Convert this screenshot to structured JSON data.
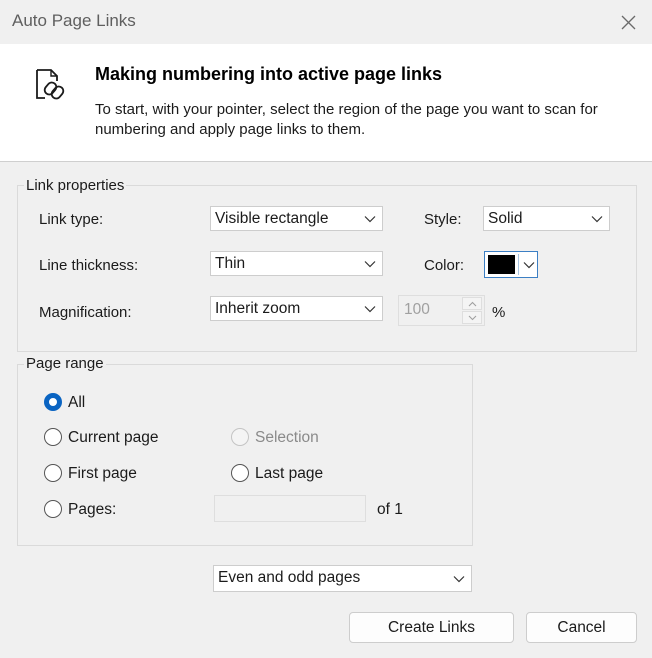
{
  "window": {
    "title": "Auto Page Links"
  },
  "header": {
    "icon": "page-link-icon",
    "heading": "Making numbering into active page links",
    "description": "To start, with your pointer, select the region of the page you want to scan for numbering and apply page links to them."
  },
  "link_properties": {
    "legend": "Link properties",
    "link_type_label": "Link type:",
    "link_type_value": "Visible rectangle",
    "style_label": "Style:",
    "style_value": "Solid",
    "line_thickness_label": "Line thickness:",
    "line_thickness_value": "Thin",
    "color_label": "Color:",
    "color_value": "#000000",
    "magnification_label": "Magnification:",
    "magnification_value": "Inherit zoom",
    "zoom_value": "100",
    "zoom_unit": "%"
  },
  "page_range": {
    "legend": "Page range",
    "all_label": "All",
    "current_page_label": "Current page",
    "selection_label": "Selection",
    "first_page_label": "First page",
    "last_page_label": "Last page",
    "pages_label": "Pages:",
    "pages_value": "",
    "of_label": "of 1",
    "selected": "All"
  },
  "subset": {
    "value": "Even and odd pages"
  },
  "buttons": {
    "create": "Create Links",
    "cancel": "Cancel"
  },
  "colors": {
    "accent": "#0a64c2"
  }
}
